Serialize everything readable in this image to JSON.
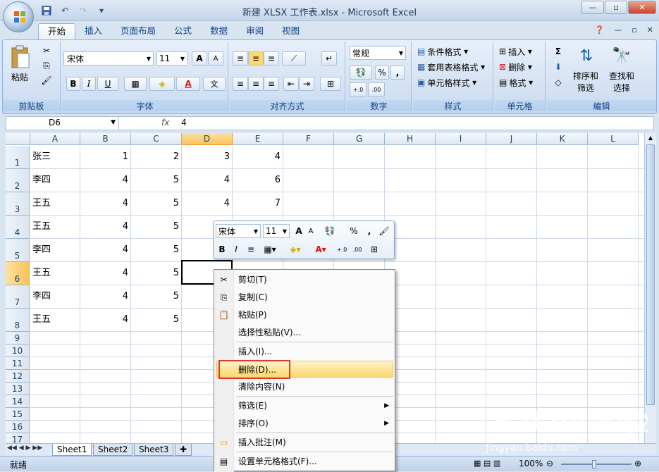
{
  "window": {
    "title": "新建 XLSX 工作表.xlsx - Microsoft Excel"
  },
  "qat": {
    "save": "save-icon",
    "undo": "↶",
    "redo": "↷"
  },
  "tabs": [
    {
      "label": "开始"
    },
    {
      "label": "插入"
    },
    {
      "label": "页面布局"
    },
    {
      "label": "公式"
    },
    {
      "label": "数据"
    },
    {
      "label": "审阅"
    },
    {
      "label": "视图"
    }
  ],
  "ribbon": {
    "clipboard": {
      "paste": "粘贴",
      "label": "剪贴板"
    },
    "font": {
      "name": "宋体",
      "size": "11",
      "label": "字体",
      "bold": "B",
      "italic": "I",
      "underline": "U",
      "grow": "A",
      "shrink": "A",
      "color_a": "A",
      "phonetic": "文"
    },
    "alignment": {
      "label": "对齐方式"
    },
    "number": {
      "format": "常规",
      "label": "数字",
      "percent": "%",
      "comma": ","
    },
    "styles": {
      "conditional": "条件格式",
      "table": "套用表格格式",
      "cell": "单元格样式",
      "label": "样式"
    },
    "cells": {
      "insert": "插入",
      "delete": "删除",
      "format": "格式",
      "label": "单元格"
    },
    "editing": {
      "sort": "排序和",
      "sort2": "筛选",
      "find": "查找和",
      "find2": "选择",
      "label": "编辑",
      "sigma": "Σ"
    }
  },
  "formula_bar": {
    "name_box": "D6",
    "fx": "fx",
    "value": "4"
  },
  "columns": [
    "A",
    "B",
    "C",
    "D",
    "E",
    "F",
    "G",
    "H",
    "I",
    "J",
    "K",
    "L"
  ],
  "rows": [
    "1",
    "2",
    "3",
    "4",
    "5",
    "6",
    "7",
    "8",
    "9",
    "10",
    "11",
    "12",
    "13",
    "14",
    "15",
    "16",
    "17"
  ],
  "cells": [
    [
      "张三",
      "1",
      "2",
      "3",
      "4"
    ],
    [
      "李四",
      "4",
      "5",
      "4",
      "6"
    ],
    [
      "王五",
      "4",
      "5",
      "4",
      "7"
    ],
    [
      "王五",
      "4",
      "5",
      "",
      ""
    ],
    [
      "李四",
      "4",
      "5",
      "",
      ""
    ],
    [
      "王五",
      "4",
      "5",
      "",
      ""
    ],
    [
      "李四",
      "4",
      "5",
      "",
      ""
    ],
    [
      "王五",
      "4",
      "5",
      "",
      ""
    ]
  ],
  "sheets": [
    "Sheet1",
    "Sheet2",
    "Sheet3"
  ],
  "status": {
    "ready": "就绪",
    "zoom": "100%"
  },
  "mini_toolbar": {
    "font": "宋体",
    "size": "11",
    "percent": "%",
    "comma": ","
  },
  "context_menu": {
    "cut": "剪切(T)",
    "copy": "复制(C)",
    "paste": "粘贴(P)",
    "paste_special": "选择性粘贴(V)...",
    "insert": "插入(I)...",
    "delete": "删除(D)...",
    "clear": "清除内容(N)",
    "filter": "筛选(E)",
    "sort": "排序(O)",
    "insert_comment": "插入批注(M)",
    "format_cells": "设置单元格格式(F)..."
  },
  "watermark": {
    "brand": "Bai du 经验",
    "url": "jingyan.baidu.com"
  }
}
